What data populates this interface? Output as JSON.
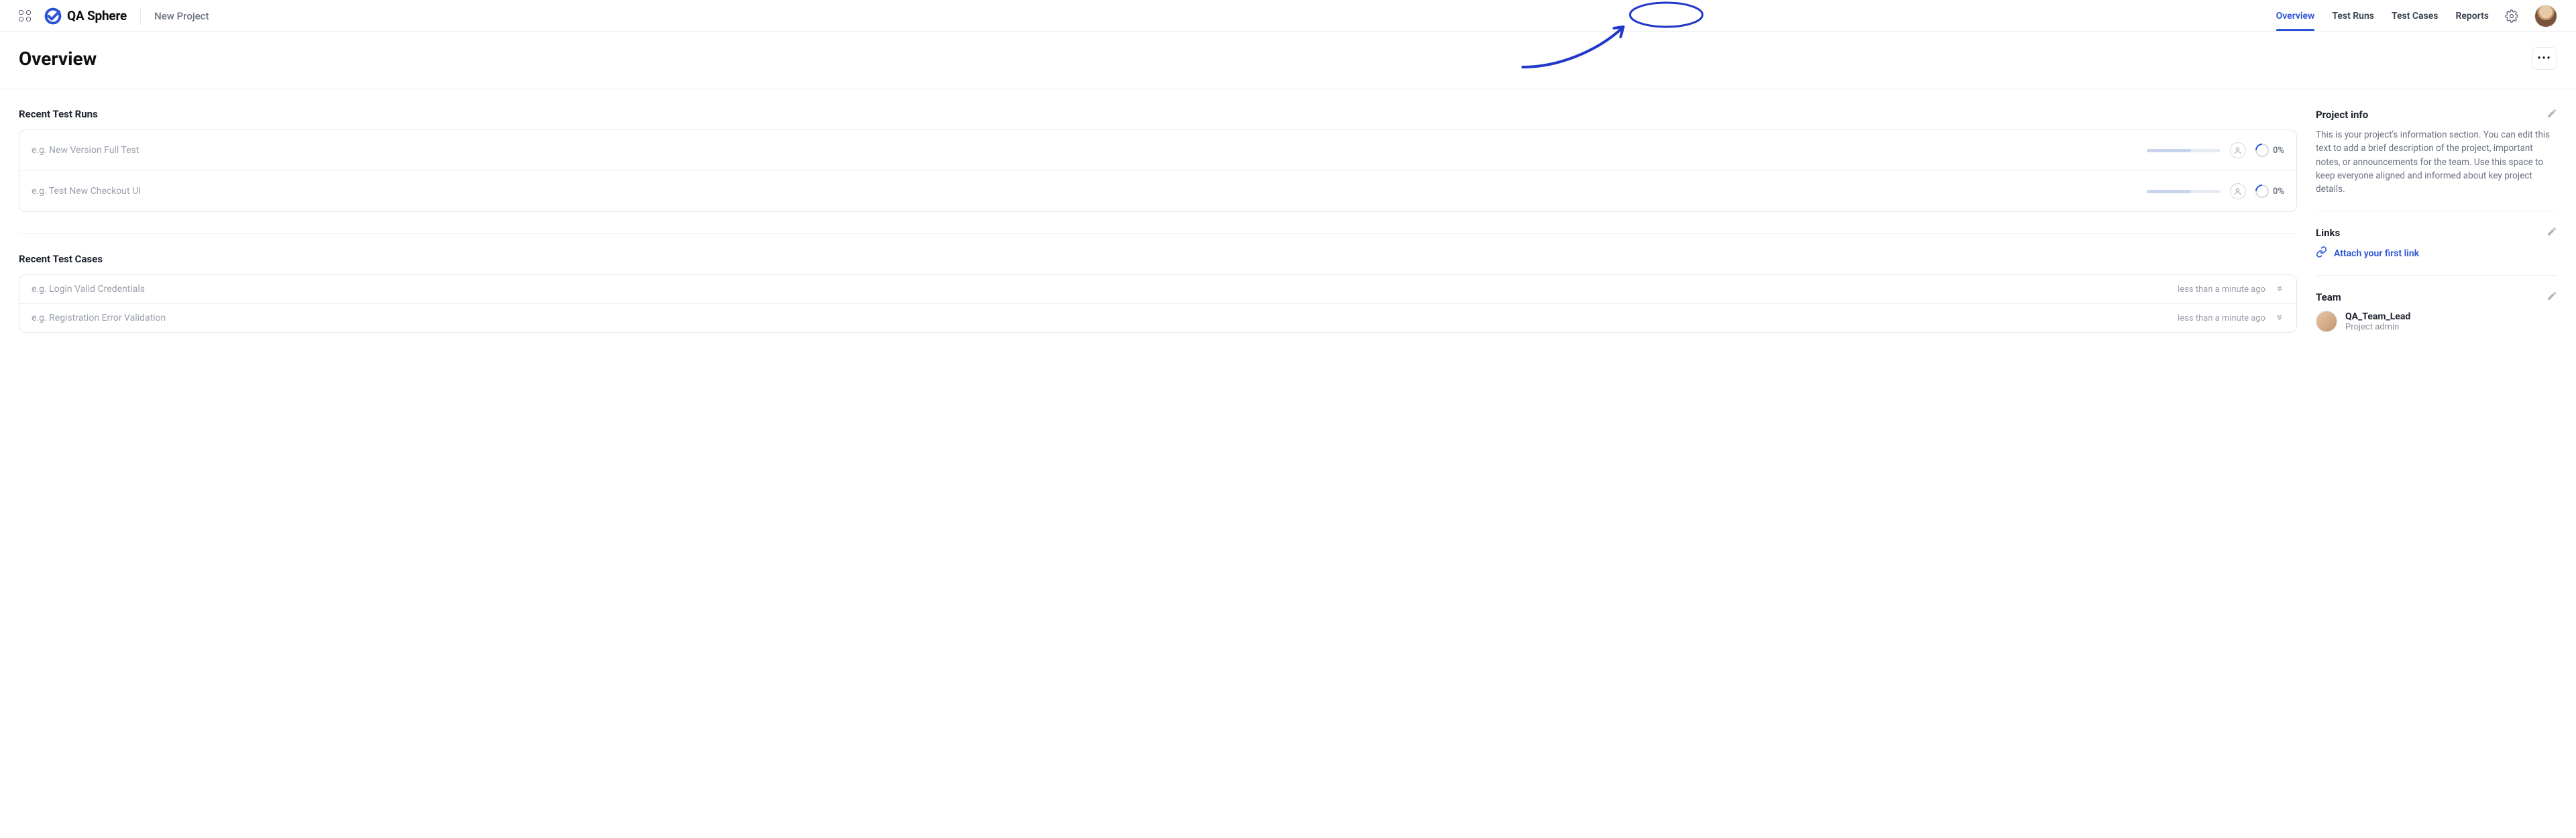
{
  "brand": {
    "name": "QA Sphere"
  },
  "project_name": "New Project",
  "nav_tabs": [
    "Overview",
    "Test Runs",
    "Test Cases",
    "Reports"
  ],
  "nav_active_index": 0,
  "nav_highlighted_index": 2,
  "page_title": "Overview",
  "main": {
    "recent_runs_title": "Recent Test Runs",
    "runs": [
      {
        "name": "e.g. New Version Full Test",
        "percent": "0%"
      },
      {
        "name": "e.g. Test New Checkout UI",
        "percent": "0%"
      }
    ],
    "recent_cases_title": "Recent Test Cases",
    "cases": [
      {
        "name": "e.g. Login Valid Credentials",
        "time": "less than a minute ago"
      },
      {
        "name": "e.g. Registration Error Validation",
        "time": "less than a minute ago"
      }
    ]
  },
  "sidebar": {
    "project_info_title": "Project info",
    "project_info_body": "This is your project's information section. You can edit this text to add a brief description of the project, important notes, or announcements for the team. Use this space to keep everyone aligned and informed about key project details.",
    "links_title": "Links",
    "links_action": "Attach your first link",
    "team_title": "Team",
    "team": [
      {
        "name": "QA_Team_Lead",
        "role": "Project admin"
      }
    ]
  }
}
